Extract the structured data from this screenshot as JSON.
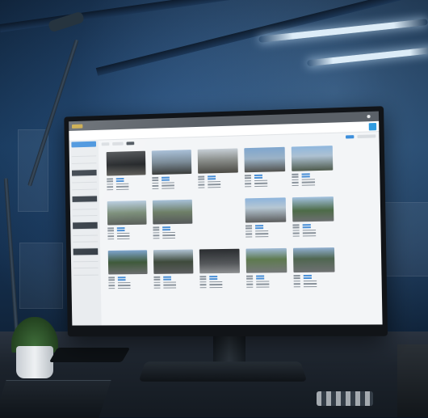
{
  "screen_app": {
    "menu": [
      "",
      "",
      "",
      "",
      ""
    ],
    "user_label": "",
    "sidebar_items": [
      "",
      "",
      "",
      "",
      "",
      "",
      "",
      "",
      "",
      "",
      "",
      "",
      "",
      "",
      "",
      "",
      "",
      "",
      ""
    ],
    "photo_count": 15
  },
  "colors": {
    "accent": "#3f8fdc",
    "topbar": "#5b6168",
    "screen_bg": "#f3f5f7",
    "ambient": "#18385a"
  },
  "icons": [
    "user-icon",
    "grid-view-icon"
  ]
}
